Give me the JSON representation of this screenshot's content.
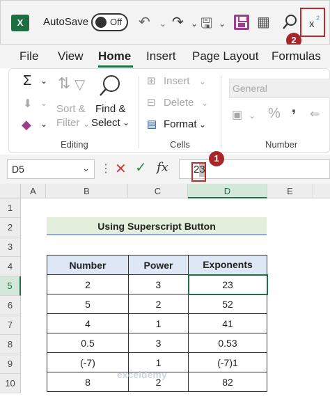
{
  "titlebar": {
    "app_logo": "X",
    "autosave_label": "AutoSave",
    "autosave_state": "Off",
    "superscript_label": "x",
    "superscript_sup": "2"
  },
  "badges": {
    "one": "1",
    "two": "2"
  },
  "menu": {
    "tabs": [
      "File",
      "View",
      "Home",
      "Insert",
      "Page Layout",
      "Formulas"
    ],
    "active": "Home"
  },
  "ribbon": {
    "editing": {
      "sort_filter_1": "Sort &",
      "sort_filter_2": "Filter",
      "find_select_1": "Find &",
      "find_select_2": "Select",
      "group_label": "Editing"
    },
    "cells": {
      "insert": "Insert",
      "delete": "Delete",
      "format": "Format",
      "group_label": "Cells"
    },
    "number": {
      "format_value": "General",
      "percent": "%",
      "comma": "❜",
      "group_label": "Number"
    }
  },
  "formula_bar": {
    "name_box": "D5",
    "fx": "fx",
    "value": "23"
  },
  "grid": {
    "columns": [
      "A",
      "B",
      "C",
      "D",
      "E"
    ],
    "rows": [
      "1",
      "2",
      "3",
      "4",
      "5",
      "6",
      "7",
      "8",
      "9",
      "10"
    ],
    "active_cell": "D5",
    "title": "Using Superscript Button",
    "table_headers": [
      "Number",
      "Power",
      "Exponents"
    ],
    "table_rows": [
      [
        "2",
        "3",
        "23"
      ],
      [
        "5",
        "2",
        "52"
      ],
      [
        "4",
        "1",
        "41"
      ],
      [
        "0.5",
        "3",
        "0.53"
      ],
      [
        "(-7)",
        "1",
        "(-7)1"
      ],
      [
        "8",
        "2",
        "82"
      ]
    ]
  },
  "watermark": "exceldemy",
  "colors": {
    "excel_green": "#1e7145",
    "highlight_red": "#c0282a",
    "badge_red": "#a6262a",
    "title_fill": "#e2efda",
    "header_fill": "#dde7f5"
  }
}
